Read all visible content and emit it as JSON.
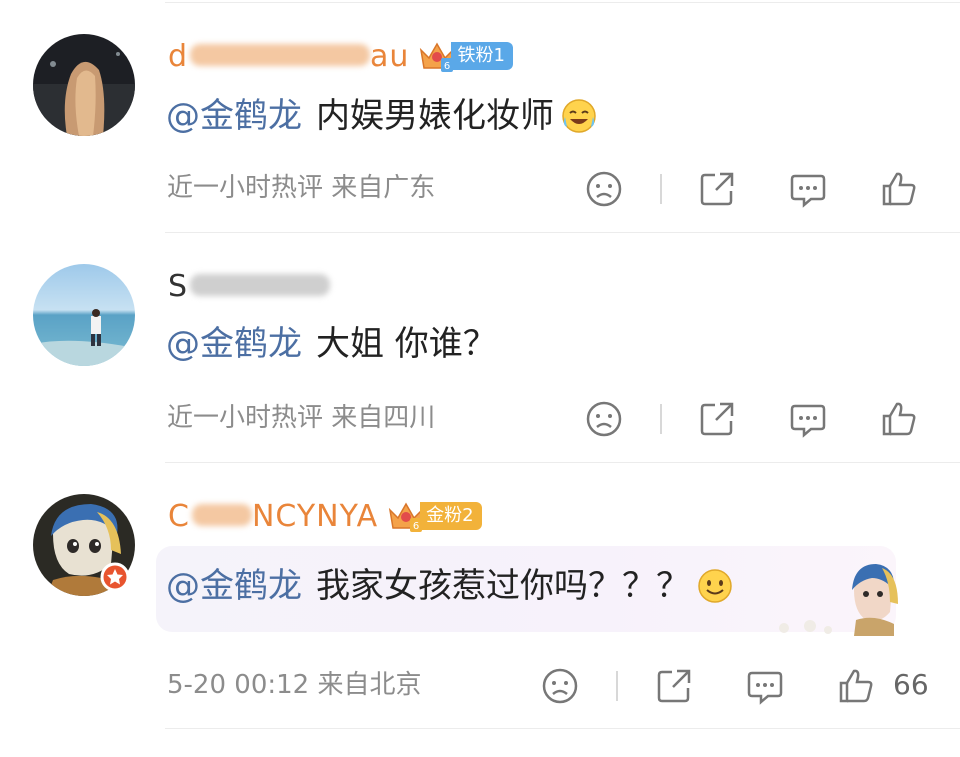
{
  "comments": [
    {
      "username": "d    f    cau",
      "badge": {
        "level": "6",
        "label": "铁粉1",
        "color": "#5aa8e8"
      },
      "mention": "@金鹤龙",
      "text": "内娱男婊化妆师",
      "emoji": "laughing-crying-emoji",
      "meta": "近一小时热评  来自广东",
      "likes": ""
    },
    {
      "username": "S",
      "mention": "@金鹤龙",
      "text": "大姐 你谁？",
      "meta": "近一小时热评  来自四川",
      "likes": ""
    },
    {
      "username": "C    NCYNYA",
      "badge": {
        "level": "6",
        "label": "金粉2",
        "color": "#f2b23a"
      },
      "mention": "@金鹤龙",
      "text": "我家女孩惹过你吗？？？",
      "emoji": "smile-emoji",
      "meta": "5-20 00:12  来自北京",
      "likes": "66"
    }
  ],
  "colors": {
    "mention": "#4c6fa3",
    "meta": "#8c8c8c",
    "orange_name": "#e9853a"
  }
}
